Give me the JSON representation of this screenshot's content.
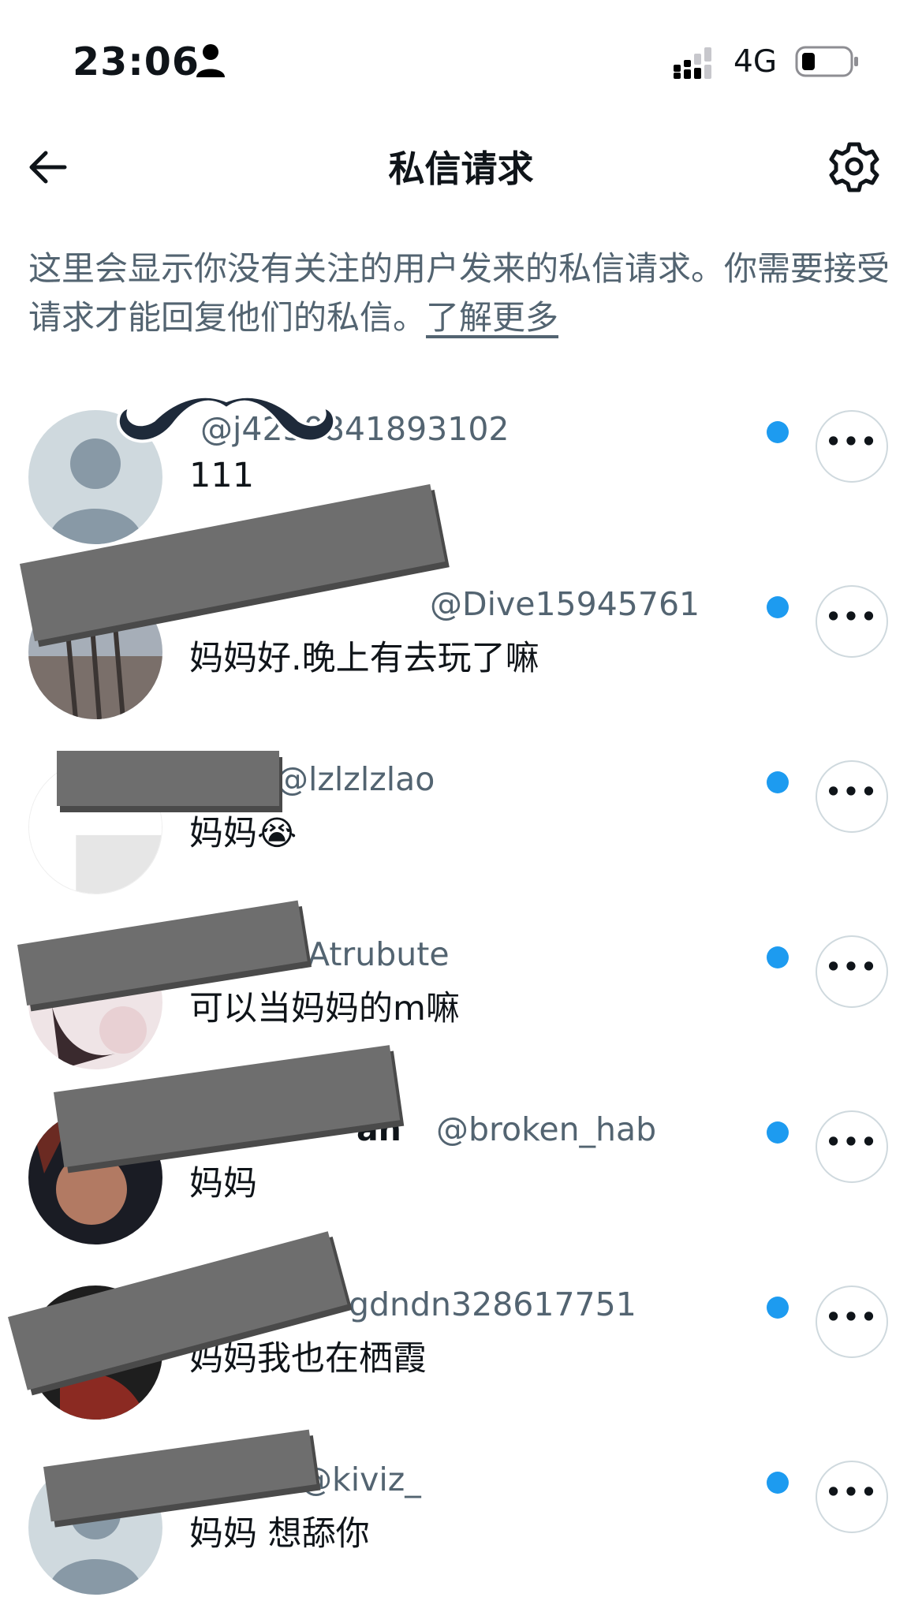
{
  "status_bar": {
    "time": "23:06",
    "network": "4G",
    "icons": [
      "person-icon",
      "signal-icon",
      "battery-icon"
    ]
  },
  "header": {
    "title": "私信请求",
    "back_icon": "arrow-left-icon",
    "settings_icon": "gear-icon"
  },
  "intro": {
    "text": "这里会显示你没有关注的用户发来的私信请求。你需要接受请求才能回复他们的私信。",
    "link_label": "了解更多"
  },
  "requests": [
    {
      "display_name": "",
      "handle": "@j4230841893102",
      "message": "111",
      "unread": true
    },
    {
      "display_name": "",
      "handle": "@Dive15945761",
      "message": "妈妈好.晚上有去玩了嘛",
      "unread": true
    },
    {
      "display_name": "",
      "handle": "@lzlzlzlao",
      "message": "妈妈😭",
      "unread": true
    },
    {
      "display_name": "",
      "handle": "Atrubute",
      "message": "可以当妈妈的m嘛",
      "unread": true
    },
    {
      "display_name": "an",
      "handle": "@broken_hab",
      "message": "妈妈",
      "unread": true
    },
    {
      "display_name": "",
      "handle": "gdndn328617751",
      "message": "妈妈我也在栖霞",
      "unread": true
    },
    {
      "display_name": "",
      "handle": "@kiviz_",
      "message": "妈妈 想舔你",
      "unread": true
    }
  ],
  "more_label": "•••",
  "colors": {
    "accent": "#1d9bf0",
    "secondary_text": "#536471",
    "primary_text": "#0f1419",
    "redaction": "#6e6e6e"
  }
}
